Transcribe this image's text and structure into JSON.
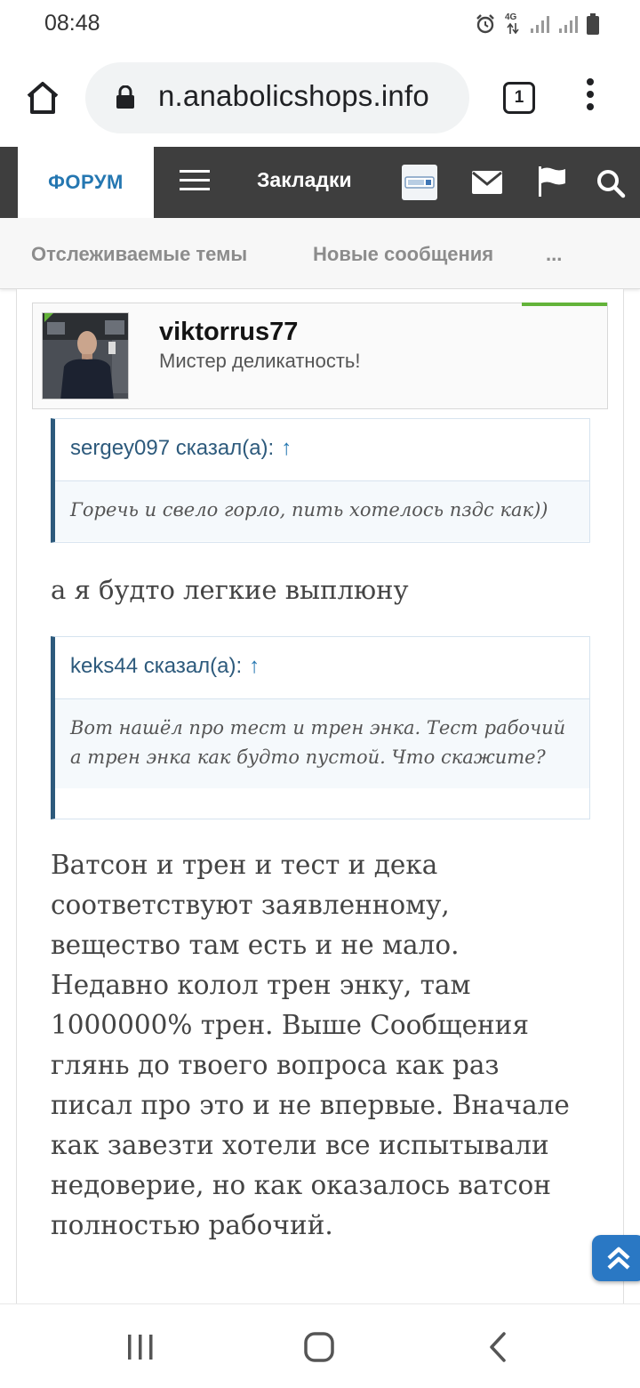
{
  "status_bar": {
    "time": "08:48",
    "network": "4G",
    "icons": [
      "alarm-icon",
      "4g-data-icon",
      "signal-icon",
      "signal-icon-2",
      "battery-icon"
    ]
  },
  "browser": {
    "url": "n.anabolicshops.info",
    "tab_count": "1",
    "icons": [
      "home-icon",
      "lock-icon",
      "tabs-icon",
      "overflow-menu-icon"
    ]
  },
  "forum_nav": {
    "active_tab": "ФОРУМ",
    "bookmarks_label": "Закладки",
    "icons": [
      "menu-icon",
      "avatar-icon",
      "mail-icon",
      "flag-icon",
      "search-icon"
    ]
  },
  "sub_nav": {
    "items": [
      "Отслеживаемые темы",
      "Новые сообщения",
      "..."
    ]
  },
  "post": {
    "author": {
      "name": "viktorrus77",
      "title": "Мистер деликатность!"
    },
    "quotes": [
      {
        "header": "sergey097 сказал(а):",
        "arrow": "↑",
        "text": "Горечь и свело горло, пить хотелось пздс как))"
      },
      {
        "header": "keks44 сказал(а):",
        "arrow": "↑",
        "text": "Вот нашёл про тест и трен энка. Тест рабочий а трен энка как будто пустой. Что скажите?"
      }
    ],
    "reply_1": "а я будто легкие выплюну",
    "reply_2": "Ватсон и трен и тест и дека соответствуют заявленному, вещество там есть и не мало. Недавно колол трен энку, там 1000000% трен. Выше Сообщения глянь до твоего вопроса как раз писал про это и не впервые. Вначале как завезти хотели все испытывали недоверие, но как оказалось ватсон полностью рабочий."
  },
  "colors": {
    "nav_dark": "#3e3e3e",
    "accent_blue": "#2577b1",
    "quote_border": "#2d5a7c",
    "online_green": "#63b339"
  },
  "android_nav": {
    "icons": [
      "recents-icon",
      "home-nav-icon",
      "back-icon"
    ]
  }
}
